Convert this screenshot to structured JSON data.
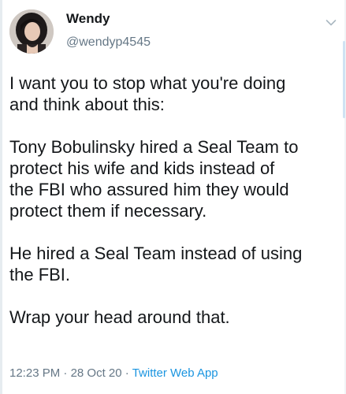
{
  "tweet": {
    "display_name": "Wendy",
    "handle": "@wendyp4545",
    "paragraphs": [
      [
        "I want you to stop what you're doing",
        "and think about this:"
      ],
      [
        "Tony Bobulinsky hired a Seal Team to",
        "protect his wife and kids instead of",
        "the FBI who assured him they would",
        "protect them if necessary."
      ],
      [
        "He hired a Seal Team instead of using",
        "the FBI."
      ],
      [
        "Wrap your head around that."
      ]
    ],
    "time": "12:23 PM",
    "separator": "·",
    "date": "28 Oct 20",
    "source": "Twitter Web App"
  },
  "icons": {
    "avatar": "profile-photo",
    "menu": "chevron-down-icon"
  },
  "colors": {
    "text": "#14171a",
    "secondary": "#657786",
    "link": "#1b95e0"
  }
}
